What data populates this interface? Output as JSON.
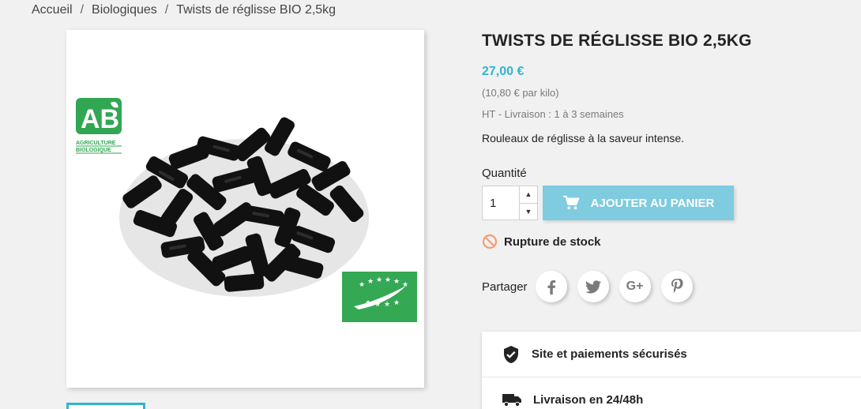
{
  "breadcrumb": {
    "items": [
      "Accueil",
      "Biologiques",
      "Twists de réglisse BIO 2,5kg"
    ],
    "separator": "/"
  },
  "product": {
    "title": "TWISTS DE RÉGLISSE BIO 2,5KG",
    "price": "27,00 €",
    "unit_price": "(10,80 € par kilo)",
    "tax_delivery": "HT - Livraison : 1 à 3 semaines",
    "description": "Rouleaux de réglisse à la saveur intense.",
    "logos": {
      "ab_main": "AB",
      "ab_line1": "AGRICULTURE",
      "ab_line2": "BIOLOGIQUE"
    }
  },
  "quantity": {
    "label": "Quantité",
    "value": "1"
  },
  "cart": {
    "add_label": "AJOUTER AU PANIER"
  },
  "stock": {
    "label": "Rupture de stock"
  },
  "share": {
    "label": "Partager",
    "networks": [
      "facebook-icon",
      "twitter-icon",
      "google-plus-icon",
      "pinterest-icon"
    ],
    "googleplus_text": "G+"
  },
  "reassurance": {
    "items": [
      "Site et paiements sécurisés",
      "Livraison en 24/48h"
    ]
  },
  "colors": {
    "accent": "#2fb5d2",
    "button": "#7fcbe0",
    "stock_icon": "#f39d72",
    "eu_green": "#34a853"
  }
}
